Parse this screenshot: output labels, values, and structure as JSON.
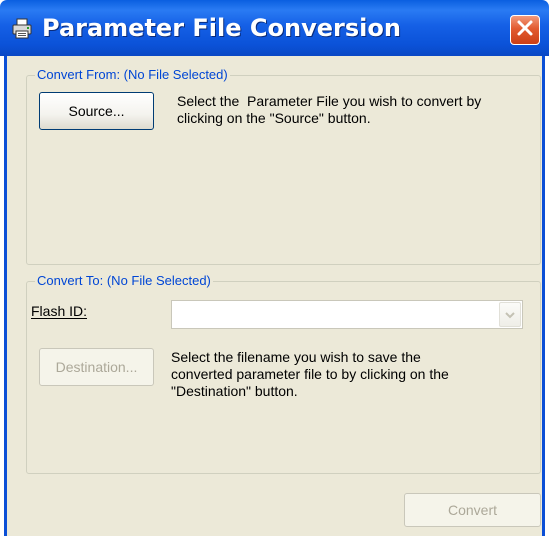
{
  "window": {
    "title": "Parameter File Conversion",
    "close_icon": "close-icon",
    "app_icon": "printer-icon"
  },
  "convert_from": {
    "legend": "Convert From: (No File Selected)",
    "source_button": "Source...",
    "description_line1": "Select the  Parameter File you wish to convert by",
    "description_line2": "clicking on the \"Source\" button."
  },
  "convert_to": {
    "legend": "Convert To: (No File Selected)",
    "flash_id_label": "Flash ID:",
    "flash_id_value": "",
    "destination_button": "Destination...",
    "description_line1": "Select the filename you wish to save the",
    "description_line2": "converted parameter file to by clicking on the",
    "description_line3": "\"Destination\" button."
  },
  "footer": {
    "convert_button": "Convert"
  },
  "colors": {
    "titlebar": "#0b52d8",
    "legend_text": "#0046d5",
    "dialog_bg": "#ece9d8",
    "close_button": "#e25a2f"
  }
}
